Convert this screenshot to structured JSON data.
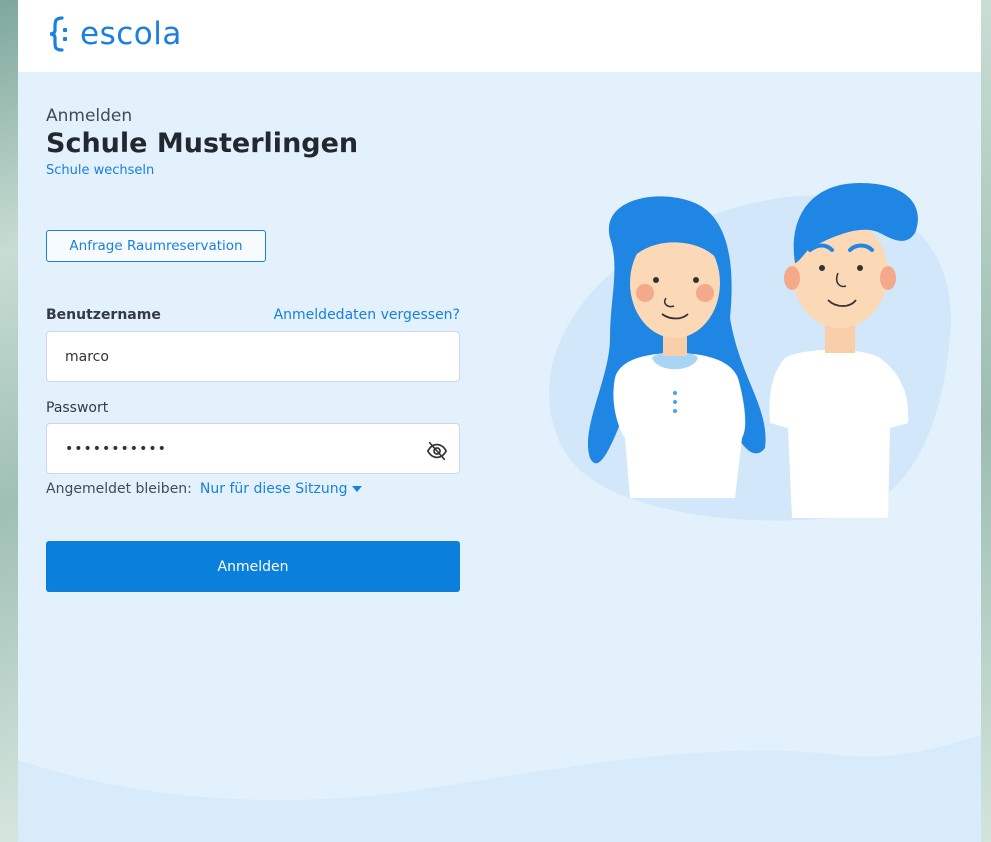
{
  "brand": {
    "name": "escola",
    "accent": "#1a7fe0",
    "icon": "escola-brace-logo-icon"
  },
  "login": {
    "kicker": "Anmelden",
    "school_name": "Schule Musterlingen",
    "switch_school": "Schule wechseln",
    "room_request_button": "Anfrage Raumreservation",
    "username_label": "Benutzername",
    "forgot_link": "Anmeldedaten vergessen?",
    "username_value": "marco",
    "password_label": "Passwort",
    "password_value": "•••••••••••",
    "password_toggle_icon": "eye-off-icon",
    "stay_label": "Angemeldet bleiben:",
    "stay_value": "Nur für diese Sitzung",
    "submit_label": "Anmelden"
  },
  "colors": {
    "background": "#e3f1fd",
    "button": "#0a7fdc",
    "topbar": "#ffffff"
  }
}
